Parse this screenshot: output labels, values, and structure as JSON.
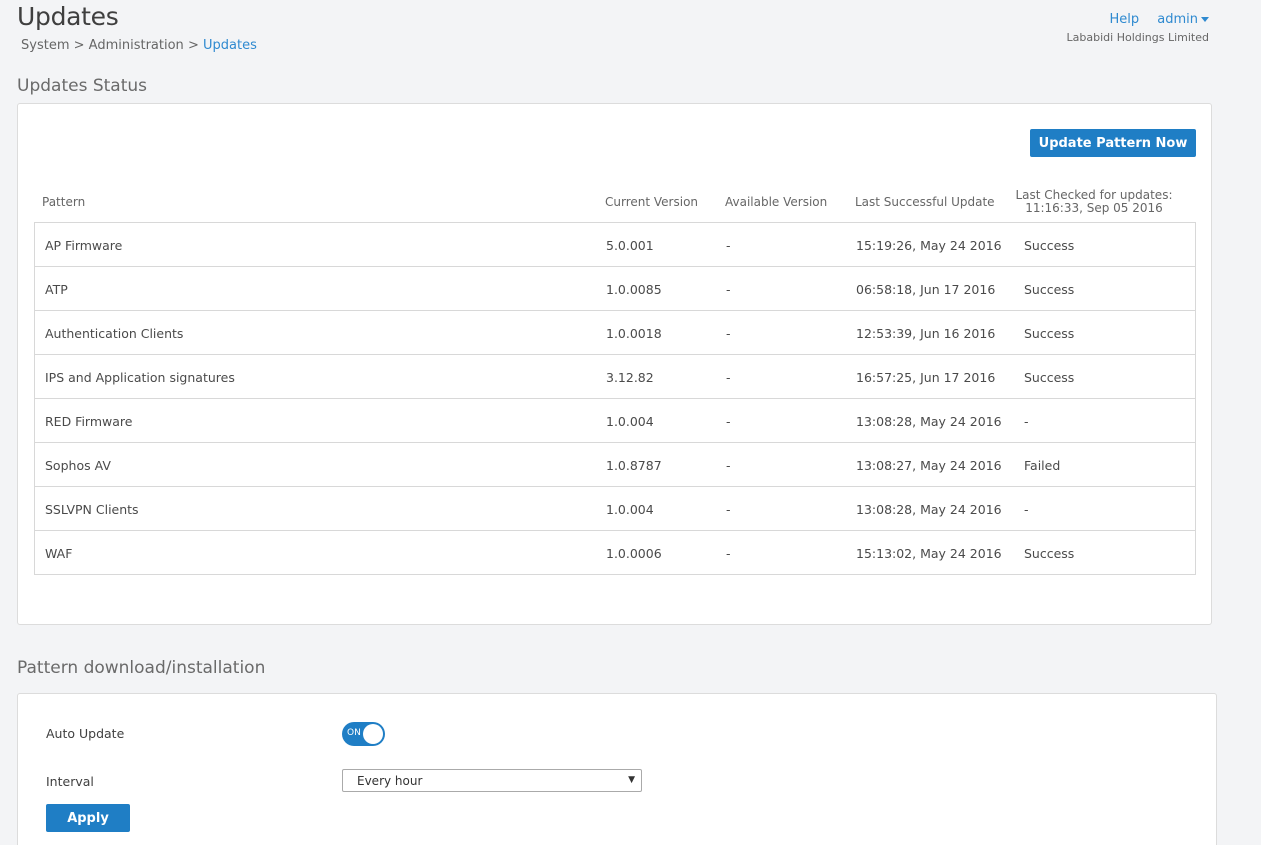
{
  "header": {
    "title": "Updates",
    "breadcrumb": {
      "level1": "System",
      "sep": ">",
      "level2": "Administration",
      "level3": "Updates"
    },
    "help_label": "Help",
    "user_label": "admin",
    "company": "Lababidi Holdings Limited"
  },
  "status": {
    "section_title": "Updates Status",
    "update_button": "Update Pattern Now",
    "columns": {
      "pattern": "Pattern",
      "current_version": "Current Version",
      "available_version": "Available Version",
      "last_successful_update": "Last Successful Update",
      "last_checked_line1": "Last Checked for updates:",
      "last_checked_line2": "11:16:33, Sep 05 2016"
    },
    "rows": [
      {
        "pattern": "AP Firmware",
        "current": "5.0.001",
        "available": "-",
        "last_update": "15:19:26, May 24 2016",
        "checked": "Success"
      },
      {
        "pattern": "ATP",
        "current": "1.0.0085",
        "available": "-",
        "last_update": "06:58:18, Jun 17 2016",
        "checked": "Success"
      },
      {
        "pattern": "Authentication Clients",
        "current": "1.0.0018",
        "available": "-",
        "last_update": "12:53:39, Jun 16 2016",
        "checked": "Success"
      },
      {
        "pattern": "IPS and Application signatures",
        "current": "3.12.82",
        "available": "-",
        "last_update": "16:57:25, Jun 17 2016",
        "checked": "Success"
      },
      {
        "pattern": "RED Firmware",
        "current": "1.0.004",
        "available": "-",
        "last_update": "13:08:28, May 24 2016",
        "checked": "-"
      },
      {
        "pattern": "Sophos AV",
        "current": "1.0.8787",
        "available": "-",
        "last_update": "13:08:27, May 24 2016",
        "checked": "Failed"
      },
      {
        "pattern": "SSLVPN Clients",
        "current": "1.0.004",
        "available": "-",
        "last_update": "13:08:28, May 24 2016",
        "checked": "-"
      },
      {
        "pattern": "WAF",
        "current": "1.0.0006",
        "available": "-",
        "last_update": "15:13:02, May 24 2016",
        "checked": "Success"
      }
    ]
  },
  "download": {
    "section_title": "Pattern download/installation",
    "auto_update_label": "Auto Update",
    "toggle_state": "ON",
    "interval_label": "Interval",
    "interval_value": "Every hour",
    "apply_label": "Apply"
  },
  "colors": {
    "accent": "#1f7ec5",
    "link": "#2f8ad0",
    "background": "#f3f4f6"
  }
}
